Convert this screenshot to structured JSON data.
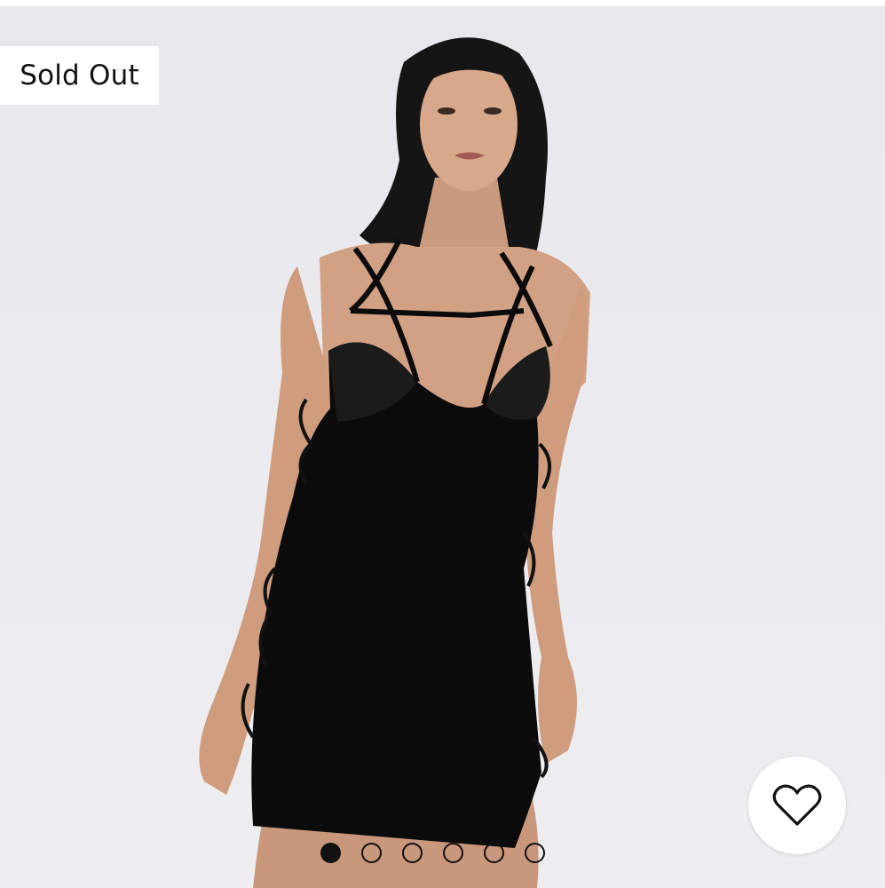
{
  "listing": {
    "badge": "Sold Out",
    "image_count": 6,
    "active_image": 1
  },
  "colors": {
    "badge_bg": "#ffffff",
    "badge_text": "#111111",
    "dot": "#111111",
    "background": "#ebebef"
  },
  "icons": {
    "favorite": "heart-outline-icon"
  }
}
